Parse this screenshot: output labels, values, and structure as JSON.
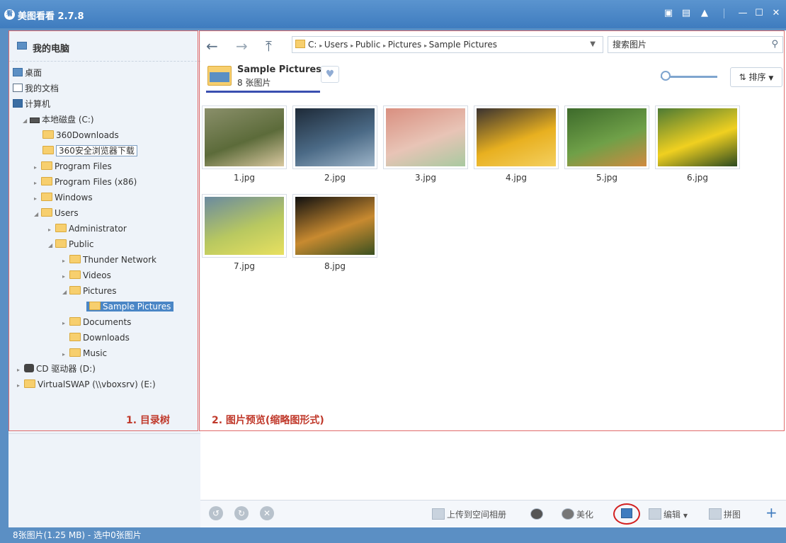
{
  "app": {
    "title": "美图看看 2.7.8",
    "logo": "看"
  },
  "titlebar": {
    "buttons": [
      "chat-icon",
      "skin-icon",
      "shirt-icon",
      "minimize-icon",
      "maximize-icon",
      "close-icon"
    ]
  },
  "tree": {
    "header": "我的电脑",
    "items": [
      {
        "label": "桌面",
        "icon": "desktop-icon"
      },
      {
        "label": "我的文档",
        "icon": "documents-icon"
      },
      {
        "label": "计算机",
        "icon": "computer-icon"
      },
      {
        "label": "本地磁盘 (C:)",
        "icon": "drive-icon"
      },
      {
        "label": "360Downloads"
      },
      {
        "label": "360安全浏览器下载"
      },
      {
        "label": "Program Files"
      },
      {
        "label": "Program Files (x86)"
      },
      {
        "label": "Windows"
      },
      {
        "label": "Users"
      },
      {
        "label": "Administrator"
      },
      {
        "label": "Public"
      },
      {
        "label": "Thunder Network"
      },
      {
        "label": "Videos"
      },
      {
        "label": "Pictures"
      },
      {
        "label": "Sample Pictures"
      },
      {
        "label": "Documents"
      },
      {
        "label": "Downloads"
      },
      {
        "label": "Music"
      },
      {
        "label": "CD 驱动器 (D:)",
        "icon": "cd-icon"
      },
      {
        "label": "VirtualSWAP (\\\\vboxsrv) (E:)"
      }
    ],
    "annotation": "1. 目录树"
  },
  "toolbar": {
    "back": "←",
    "forward": "→",
    "up": "⤒",
    "breadcrumb": [
      "C:",
      "Users",
      "Public",
      "Pictures",
      "Sample Pictures"
    ],
    "search_placeholder": "搜索图片"
  },
  "folder": {
    "name": "Sample Pictures",
    "count": "8 张图片",
    "sort_label": "排序"
  },
  "thumbnails": [
    {
      "name": "1.jpg",
      "colors": [
        "#8a8f6a",
        "#5c6b3a",
        "#d9c8a0"
      ]
    },
    {
      "name": "2.jpg",
      "colors": [
        "#1e2a38",
        "#4b6a86",
        "#9db4c8"
      ]
    },
    {
      "name": "3.jpg",
      "colors": [
        "#d98f80",
        "#e8c4b6",
        "#a8c9a0"
      ]
    },
    {
      "name": "4.jpg",
      "colors": [
        "#3a3230",
        "#e8b020",
        "#f4d060"
      ]
    },
    {
      "name": "5.jpg",
      "colors": [
        "#3d6a2b",
        "#6fa048",
        "#d08a40"
      ]
    },
    {
      "name": "6.jpg",
      "colors": [
        "#4d7a34",
        "#f0d020",
        "#2b4a20"
      ]
    },
    {
      "name": "7.jpg",
      "colors": [
        "#6a8aa0",
        "#b8c860",
        "#e8e060"
      ]
    },
    {
      "name": "8.jpg",
      "colors": [
        "#101010",
        "#c88a30",
        "#3a5020"
      ]
    }
  ],
  "preview_annotation": "2. 图片预览(缩略图形式)",
  "bottombar": {
    "upload_label": "上传到空间相册",
    "beautify_label": "美化",
    "edit_label": "编辑",
    "collage_label": "拼图"
  },
  "status": {
    "text": "8张图片(1.25 MB) - 选中0张图片"
  }
}
